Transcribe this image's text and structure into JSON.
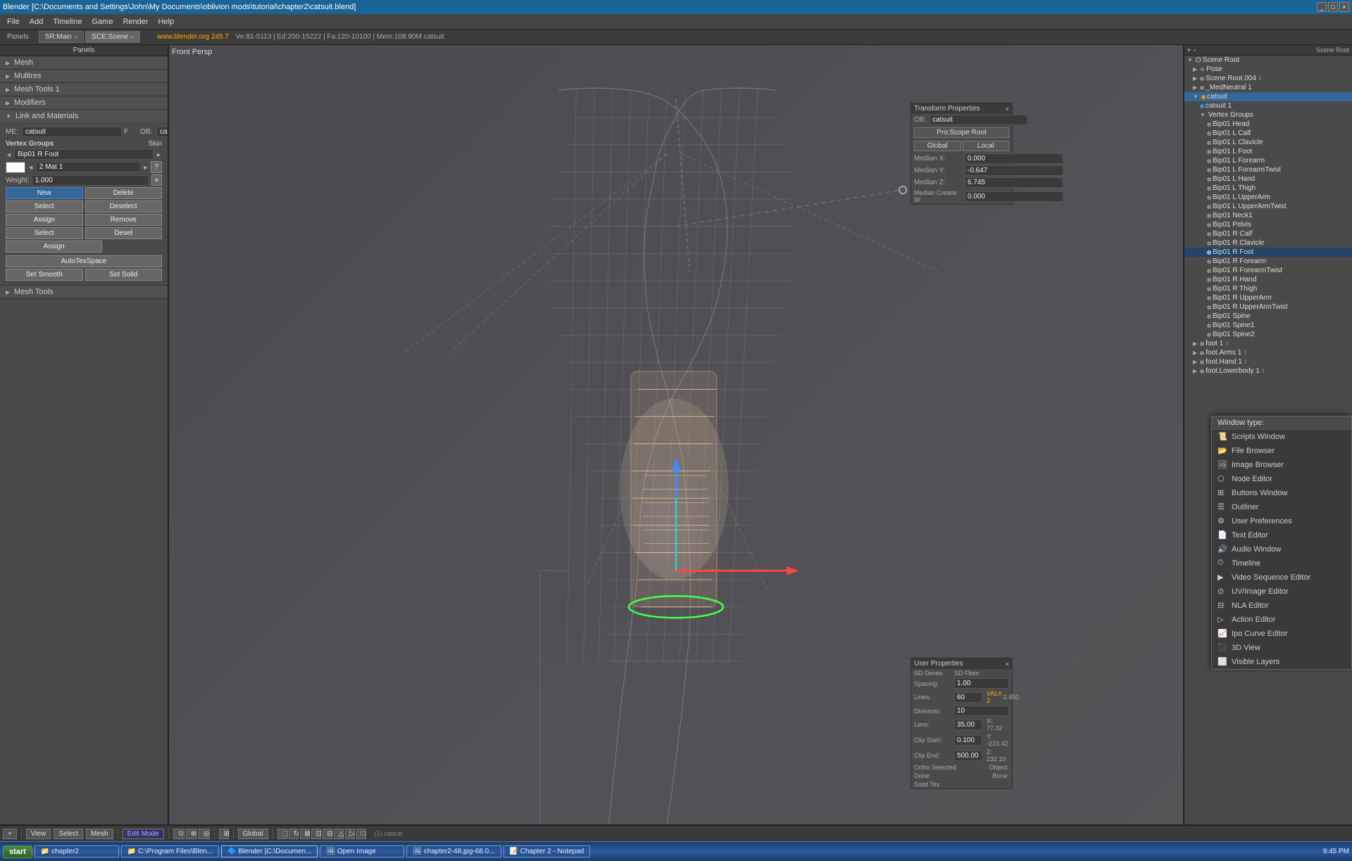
{
  "titlebar": {
    "title": "Blender [C:\\Documents and Settings\\John\\My Documents\\oblivion mods\\tutorial\\chapter2\\catsuit.blend]",
    "controls": [
      "_",
      "□",
      "×"
    ]
  },
  "menubar": {
    "items": [
      "File",
      "Add",
      "Timeline",
      "Game",
      "Render",
      "Help"
    ]
  },
  "tabs": [
    {
      "label": "SR:Main",
      "active": false
    },
    {
      "label": "SCE:Scene",
      "active": true
    }
  ],
  "statusbar": {
    "object": "OB:catsuit",
    "stats": "Ve:81-5113 | Ed:200-15222 | Fa:120-10100 | Mem:108.90M catsuit",
    "website": "www.blender.org 245.7",
    "website_color": "orange"
  },
  "left_panel": {
    "panels_label": "Panels",
    "sections": [
      {
        "id": "mesh",
        "label": "Mesh",
        "expanded": false
      },
      {
        "id": "multires",
        "label": "Multires",
        "expanded": false
      },
      {
        "id": "mesh_tools_1",
        "label": "Mesh Tools 1",
        "expanded": false
      },
      {
        "id": "modifiers",
        "label": "Modifiers",
        "expanded": false
      },
      {
        "id": "link_materials",
        "label": "Link and Materials",
        "expanded": true,
        "fields": {
          "me_label": "ME:",
          "me_value": "catsuit",
          "f_label": "F",
          "ob_label": "OB:",
          "ob_value": "catsuit"
        },
        "vertex_groups": {
          "label": "Vertex Groups",
          "skin_label": "Skin",
          "group_name": "Bip01 R Foot",
          "color_swatch": "white",
          "mat_label": "2 Mat 1",
          "weight_label": "Weight:",
          "weight_value": "1.000",
          "buttons": {
            "new": "New",
            "delete": "Delete",
            "select": "Select",
            "deselect": "Deselect",
            "assign": "Assign",
            "remove": "Remove",
            "sel": "Select",
            "desel": "Desel"
          }
        },
        "buttons": {
          "autotexspace": "AutoTexSpace",
          "set_smooth": "Set Smooth",
          "set_solid": "Set Solid"
        }
      },
      {
        "id": "mesh_tools",
        "label": "Mesh Tools",
        "expanded": false
      }
    ]
  },
  "viewport": {
    "label": "Front Persp",
    "mode": "Edit Mode"
  },
  "transform_panel": {
    "title": "Transform Properties",
    "ob_label": "OB:",
    "ob_value": "catsuit",
    "scope_options": [
      "Pro:Scope Root",
      "Global",
      "Local"
    ],
    "rows": [
      {
        "label": "Median X:",
        "value": "0.000"
      },
      {
        "label": "Median Y:",
        "value": "-0.647"
      },
      {
        "label": "Median Z:",
        "value": "6.745"
      },
      {
        "label": "Median Crease W:",
        "value": "0.000"
      }
    ]
  },
  "outliner": {
    "title": "Scene Root",
    "items": [
      {
        "label": "Scene Root",
        "level": 0,
        "expanded": true,
        "type": "scene"
      },
      {
        "label": "Pose",
        "level": 1,
        "expanded": false,
        "type": "pose"
      },
      {
        "label": "Scene Root.004",
        "level": 1,
        "expanded": false,
        "type": "object"
      },
      {
        "label": "_MedNeutral 1",
        "level": 1,
        "expanded": false,
        "type": "object"
      },
      {
        "label": "catsuit",
        "level": 1,
        "expanded": true,
        "type": "object",
        "selected": true
      },
      {
        "label": "catsuit 1",
        "level": 2,
        "expanded": false,
        "type": "mesh"
      },
      {
        "label": "Vertex Groups",
        "level": 2,
        "expanded": true,
        "type": "group"
      },
      {
        "label": "Bip01 Head",
        "level": 3,
        "type": "vertex_group"
      },
      {
        "label": "Bip01 L Calf",
        "level": 3,
        "type": "vertex_group"
      },
      {
        "label": "Bip01 L Clavicle",
        "level": 3,
        "type": "vertex_group"
      },
      {
        "label": "Bip01 L Foot",
        "level": 3,
        "type": "vertex_group"
      },
      {
        "label": "Bip01 L Forearm",
        "level": 3,
        "type": "vertex_group"
      },
      {
        "label": "Bip01 L ForearmTwist",
        "level": 3,
        "type": "vertex_group"
      },
      {
        "label": "Bip01 L Hand",
        "level": 3,
        "type": "vertex_group"
      },
      {
        "label": "Bip01 L Thigh",
        "level": 3,
        "type": "vertex_group"
      },
      {
        "label": "Bip01 L UpperArm",
        "level": 3,
        "type": "vertex_group"
      },
      {
        "label": "Bip01 L UpperArmTwist",
        "level": 3,
        "type": "vertex_group"
      },
      {
        "label": "Bip01 Neck1",
        "level": 3,
        "type": "vertex_group"
      },
      {
        "label": "Bip01 Pelvis",
        "level": 3,
        "type": "vertex_group"
      },
      {
        "label": "Bip01 R Calf",
        "level": 3,
        "type": "vertex_group"
      },
      {
        "label": "Bip01 R Clavicle",
        "level": 3,
        "type": "vertex_group"
      },
      {
        "label": "Bip01 R Foot",
        "level": 3,
        "type": "vertex_group",
        "selected": true
      },
      {
        "label": "Bip01 R Forearm",
        "level": 3,
        "type": "vertex_group"
      },
      {
        "label": "Bip01 R ForearmTwist",
        "level": 3,
        "type": "vertex_group"
      },
      {
        "label": "Bip01 R Hand",
        "level": 3,
        "type": "vertex_group"
      },
      {
        "label": "Bip01 R Thigh",
        "level": 3,
        "type": "vertex_group"
      },
      {
        "label": "Bip01 R UpperArm",
        "level": 3,
        "type": "vertex_group"
      },
      {
        "label": "Bip01 R UpperArmTwist",
        "level": 3,
        "type": "vertex_group"
      },
      {
        "label": "Bip01 Spine",
        "level": 3,
        "type": "vertex_group"
      },
      {
        "label": "Bip01 Spine1",
        "level": 3,
        "type": "vertex_group"
      },
      {
        "label": "Bip01 Spine2",
        "level": 3,
        "type": "vertex_group"
      },
      {
        "label": "foot 1",
        "level": 1,
        "expanded": false,
        "type": "object"
      },
      {
        "label": "foot.Arms 1",
        "level": 1,
        "expanded": false,
        "type": "object"
      },
      {
        "label": "foot.Hand 1",
        "level": 1,
        "expanded": false,
        "type": "object"
      },
      {
        "label": "foot.Lowerbody 1",
        "level": 1,
        "expanded": false,
        "type": "object"
      }
    ]
  },
  "window_type_dropdown": {
    "title": "Window type:",
    "items": [
      {
        "label": "Scripts Window",
        "icon": "script",
        "selected": false
      },
      {
        "label": "File Browser",
        "icon": "folder",
        "selected": false
      },
      {
        "label": "Image Browser",
        "icon": "image",
        "selected": false
      },
      {
        "label": "Node Editor",
        "icon": "node",
        "selected": false
      },
      {
        "label": "Buttons Window",
        "icon": "buttons",
        "selected": false
      },
      {
        "label": "Outliner",
        "icon": "outliner",
        "selected": false
      },
      {
        "label": "User Preferences",
        "icon": "prefs",
        "selected": false
      },
      {
        "label": "Text Editor",
        "icon": "text",
        "selected": false
      },
      {
        "label": "Audio Window",
        "icon": "audio",
        "selected": false
      },
      {
        "label": "Timeline",
        "icon": "timeline",
        "selected": false
      },
      {
        "label": "Video Sequence Editor",
        "icon": "video",
        "selected": false
      },
      {
        "label": "UV/Image Editor",
        "icon": "uv",
        "selected": false
      },
      {
        "label": "NLA Editor",
        "icon": "nla",
        "selected": false
      },
      {
        "label": "Action Editor",
        "icon": "action",
        "selected": false
      },
      {
        "label": "Ipo Curve Editor",
        "icon": "ipo",
        "selected": false
      },
      {
        "label": "3D View",
        "icon": "3d",
        "selected": false
      },
      {
        "label": "Visible Layers",
        "icon": "layers",
        "selected": false
      }
    ]
  },
  "user_props_panel": {
    "title": "User Properties",
    "rows": [
      {
        "label": "Spacing:",
        "value": "1.00"
      },
      {
        "label": "Lines:",
        "value": "60"
      },
      {
        "label": "Divisions:",
        "value": "10"
      },
      {
        "label": "Lens:",
        "value": "35.00"
      },
      {
        "label": "Clip Start:",
        "value": "0.100"
      },
      {
        "label": "Clip End:",
        "value": "500.00"
      },
      {
        "label": "Ortho Selected",
        "value": ""
      },
      {
        "label": "Object:",
        "value": ""
      },
      {
        "label": "Done:",
        "value": ""
      },
      {
        "label": "Solid Tex",
        "value": ""
      }
    ],
    "fields": {
      "sdim_label": "SD Dimen",
      "x_value": "X: 77.32",
      "y_value": "Y: -223.42",
      "z_value": "Z: 232.10",
      "vals": [
        "2.450",
        "VAL#: 2",
        "2.450"
      ]
    }
  },
  "bottom_bar": {
    "add_btn": "+",
    "view_btn": "View",
    "select_btn": "Select",
    "mesh_btn": "Mesh",
    "mode_btn": "Edit Mode",
    "global_btn": "Global",
    "pivot_options": [
      "Individual Origins",
      "Median Point",
      "Active Element"
    ]
  },
  "taskbar": {
    "start_btn": "start",
    "items": [
      {
        "label": "chapter2",
        "active": false
      },
      {
        "label": "C:\\Program Files\\Blen...",
        "active": false
      },
      {
        "label": "Blender [C:\\Documen...",
        "active": true
      },
      {
        "label": "Open Image",
        "active": false
      },
      {
        "label": "chapter2-48.jpg-68.0...",
        "active": false
      },
      {
        "label": "Chapter 2 - Notepad",
        "active": false
      }
    ],
    "time": "9:45 PM"
  }
}
